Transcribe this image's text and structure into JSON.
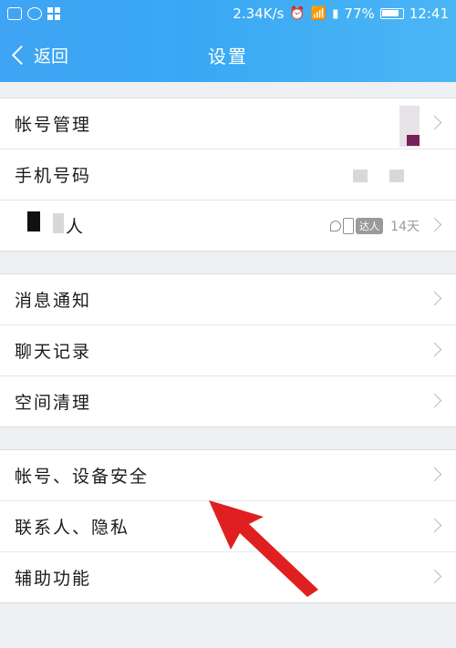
{
  "status_bar": {
    "speed": "2.34K/s",
    "battery": "77%",
    "battery_level": 0.77,
    "time": "12:41",
    "icons": [
      "chat-icon",
      "message-icon",
      "app-grid-icon",
      "alarm-icon",
      "wifi-icon",
      "signal-icon",
      "battery-icon"
    ]
  },
  "nav": {
    "back_label": "返回",
    "title": "设置"
  },
  "groups": [
    {
      "items": [
        {
          "label": "帐号管理"
        },
        {
          "label": "手机号码"
        },
        {
          "label": "人",
          "badge": "达人",
          "value": "14天"
        }
      ]
    },
    {
      "items": [
        {
          "label": "消息通知"
        },
        {
          "label": "聊天记录"
        },
        {
          "label": "空间清理"
        }
      ]
    },
    {
      "items": [
        {
          "label": "帐号、设备安全"
        },
        {
          "label": "联系人、隐私"
        },
        {
          "label": "辅助功能"
        }
      ]
    }
  ],
  "colors": {
    "header": "#3fa4f3",
    "background": "#eef0f3",
    "arrow": "#e02020"
  }
}
